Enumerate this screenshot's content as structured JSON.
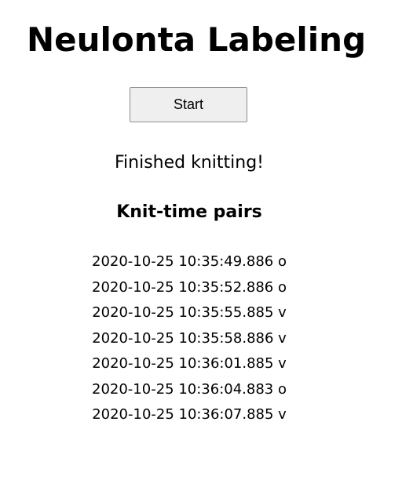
{
  "app": {
    "title": "Neulonta Labeling"
  },
  "controls": {
    "start_label": "Start"
  },
  "status": {
    "message": "Finished knitting!"
  },
  "pairs": {
    "heading": "Knit-time pairs",
    "items": [
      "2020-10-25 10:35:49.886 o",
      "2020-10-25 10:35:52.886 o",
      "2020-10-25 10:35:55.885 v",
      "2020-10-25 10:35:58.886 v",
      "2020-10-25 10:36:01.885 v",
      "2020-10-25 10:36:04.883 o",
      "2020-10-25 10:36:07.885 v"
    ]
  }
}
